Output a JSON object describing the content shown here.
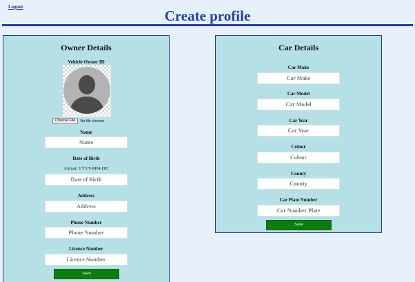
{
  "header": {
    "logout_label": "Logout",
    "page_title": "Create profile"
  },
  "owner": {
    "title": "Owner Details",
    "photo_label": "Vehicle Owner ID",
    "choose_file_label": "Choose File",
    "file_status": "No file chosen",
    "name_label": "Name",
    "name_placeholder": "Name",
    "dob_label": "Date of Birth",
    "dob_hint": "format: YYYY-MM-DD",
    "dob_placeholder": "Date of Birth",
    "address_label": "Address",
    "address_placeholder": "Address",
    "phone_label": "Phone Number",
    "phone_placeholder": "Phone Number",
    "licence_label": "Licence Number",
    "licence_placeholder": "Licence Number",
    "save_label": "Save"
  },
  "car": {
    "title": "Car Details",
    "make_label": "Car Make",
    "make_placeholder": "Car Make",
    "model_label": "Car Model",
    "model_placeholder": "Car Model",
    "year_label": "Car Year",
    "year_placeholder": "Car Year",
    "colour_label": "Colour",
    "colour_placeholder": "Colour",
    "county_label": "County",
    "county_placeholder": "County",
    "plate_label": "Car Plate Number",
    "plate_placeholder": "Car Number Plate",
    "save_label": "Save"
  },
  "colors": {
    "title_blue": "#1f3fb0",
    "panel_bg": "#b4e0e6",
    "panel_border": "#1f3a96",
    "save_green": "#0b7d0b",
    "page_bg": "#e8f1fb"
  },
  "icons": {
    "avatar": "default-user-avatar-icon"
  }
}
